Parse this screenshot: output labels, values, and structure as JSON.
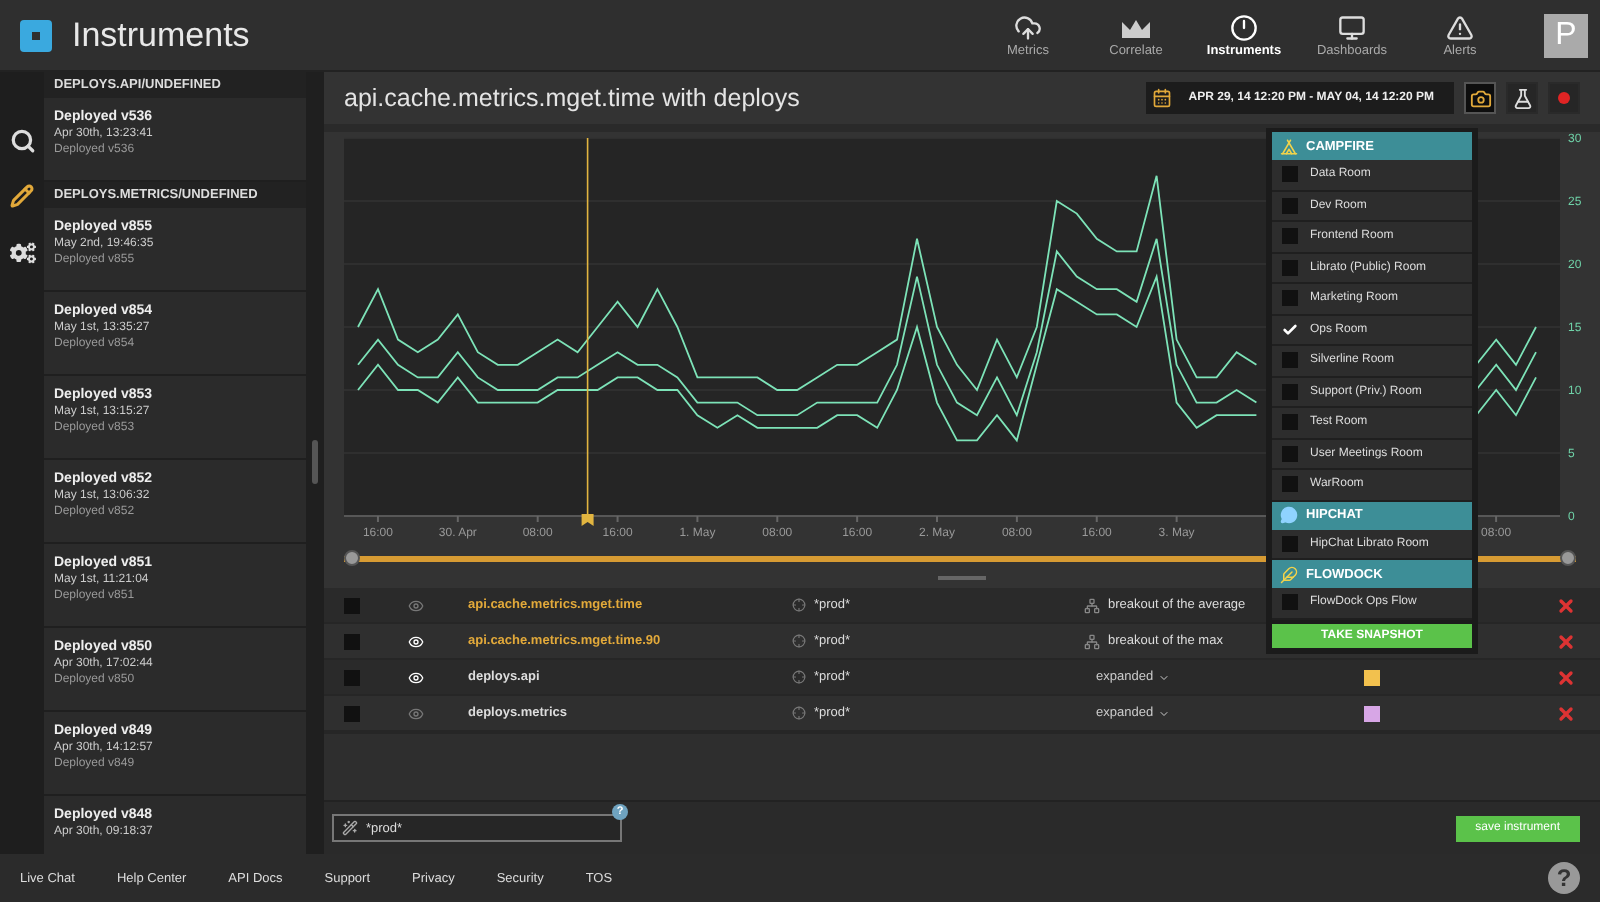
{
  "app": {
    "title": "Instruments",
    "avatar": "P"
  },
  "nav": [
    {
      "label": "Metrics",
      "kind": "metrics",
      "selected": false
    },
    {
      "label": "Correlate",
      "kind": "correlate",
      "selected": false
    },
    {
      "label": "Instruments",
      "kind": "instruments",
      "selected": true
    },
    {
      "label": "Dashboards",
      "kind": "dashboards",
      "selected": false
    },
    {
      "label": "Alerts",
      "kind": "alerts",
      "selected": false
    }
  ],
  "rail": [
    {
      "kind": "search",
      "selected": false
    },
    {
      "kind": "edit",
      "selected": true
    },
    {
      "kind": "settings",
      "selected": false
    }
  ],
  "deploys": [
    {
      "heading": "DEPLOYS.API/UNDEFINED",
      "items": [
        {
          "title": "Deployed v536",
          "time": "Apr 30th, 13:23:41",
          "note": "Deployed v536"
        }
      ]
    },
    {
      "heading": "DEPLOYS.METRICS/UNDEFINED",
      "items": [
        {
          "title": "Deployed v855",
          "time": "May 2nd, 19:46:35",
          "note": "Deployed v855"
        },
        {
          "title": "Deployed v854",
          "time": "May 1st, 13:35:27",
          "note": "Deployed v854"
        },
        {
          "title": "Deployed v853",
          "time": "May 1st, 13:15:27",
          "note": "Deployed v853"
        },
        {
          "title": "Deployed v852",
          "time": "May 1st, 13:06:32",
          "note": "Deployed v852"
        },
        {
          "title": "Deployed v851",
          "time": "May 1st, 11:21:04",
          "note": "Deployed v851"
        },
        {
          "title": "Deployed v850",
          "time": "Apr 30th, 17:02:44",
          "note": "Deployed v850"
        },
        {
          "title": "Deployed v849",
          "time": "Apr 30th, 14:12:57",
          "note": "Deployed v849"
        },
        {
          "title": "Deployed v848",
          "time": "Apr 30th, 09:18:37"
        }
      ]
    }
  ],
  "instrument": {
    "title": "api.cache.metrics.mget.time with deploys",
    "date_range": "APR 29, 14 12:20 PM - MAY 04, 14 12:20 PM",
    "tools": [
      {
        "kind": "snapshot",
        "selected": true
      },
      {
        "kind": "flask",
        "selected": false
      },
      {
        "kind": "record",
        "selected": false
      }
    ],
    "chart_data": {
      "type": "line",
      "categories": [
        null,
        "16:00",
        null,
        null,
        null,
        "30. Apr",
        null,
        null,
        null,
        "08:00",
        null,
        null,
        null,
        "16:00",
        null,
        null,
        null,
        "1. May",
        null,
        null,
        null,
        "08:00",
        null,
        null,
        null,
        "16:00",
        null,
        null,
        null,
        "2. May",
        null,
        null,
        null,
        "08:00",
        null,
        null,
        null,
        "16:00",
        null,
        null,
        null,
        "3. May",
        null,
        null,
        null,
        null,
        null,
        null,
        null,
        null,
        null,
        null,
        null,
        null,
        null,
        null,
        null,
        "08:00",
        null,
        null
      ],
      "series": [
        {
          "color": "#7de3b8",
          "values": [
            15,
            18,
            14,
            13,
            14,
            16,
            13,
            12,
            12,
            13,
            14,
            13,
            15,
            17,
            15,
            18,
            15,
            11,
            11,
            11,
            11,
            10,
            10,
            11,
            12,
            12,
            13,
            14,
            22,
            15,
            12,
            10,
            14,
            11,
            15,
            25,
            24,
            22,
            21,
            21,
            27,
            14,
            11,
            11,
            13,
            12,
            null,
            null,
            null,
            null,
            null,
            null,
            null,
            null,
            null,
            null,
            12,
            14,
            12,
            15
          ]
        },
        {
          "color": "#7de3b8",
          "values": [
            12,
            14,
            12,
            11,
            11,
            13,
            11,
            10,
            10,
            10,
            11,
            11,
            12,
            13,
            12,
            12,
            11,
            9,
            9,
            9,
            8,
            8,
            8,
            9,
            9,
            9,
            9,
            12,
            19,
            12,
            9,
            8,
            11,
            8,
            13,
            21,
            19,
            18,
            18,
            17,
            22,
            12,
            9,
            9,
            10,
            9,
            null,
            null,
            null,
            null,
            null,
            null,
            null,
            null,
            null,
            null,
            10,
            12,
            10,
            13
          ]
        },
        {
          "color": "#7de3b8",
          "values": [
            10,
            12,
            10,
            10,
            9,
            11,
            9,
            9,
            9,
            9,
            10,
            10,
            10,
            11,
            11,
            10,
            10,
            8,
            7,
            8,
            7,
            7,
            7,
            7,
            8,
            8,
            7,
            10,
            15,
            9,
            6,
            6,
            8,
            6,
            12,
            18,
            17,
            16,
            16,
            15,
            19,
            9,
            7,
            8,
            8,
            8,
            null,
            null,
            null,
            null,
            null,
            null,
            null,
            null,
            null,
            null,
            8,
            10,
            8,
            11
          ]
        }
      ],
      "ylim": [
        0,
        30
      ],
      "yticks": [
        0,
        5,
        10,
        15,
        20,
        25,
        30
      ],
      "grid": true
    },
    "navigator": {
      "level": 1
    },
    "streams": [
      {
        "kind": "metric",
        "checked": false,
        "visible": false,
        "name": "api.cache.metrics.mget.time",
        "source": "*prod*",
        "summary": "breakout of the average"
      },
      {
        "kind": "metric",
        "checked": false,
        "visible": true,
        "name": "api.cache.metrics.mget.time.90",
        "source": "*prod*",
        "summary": "breakout of the max"
      },
      {
        "kind": "annotation",
        "checked": false,
        "visible": true,
        "name": "deploys.api",
        "source": "*prod*",
        "summary": "expanded",
        "color": "#f2c14e"
      },
      {
        "kind": "annotation",
        "checked": false,
        "visible": false,
        "name": "deploys.metrics",
        "source": "*prod*",
        "summary": "expanded",
        "color": "#d7a6e6"
      }
    ],
    "filter": {
      "value": "*prod*",
      "help": "?"
    },
    "save": "save instrument"
  },
  "snapshot_menu": {
    "groups": [
      {
        "kind": "campfire",
        "name": "CAMPFIRE",
        "rooms": [
          {
            "label": "Data Room",
            "checked": false
          },
          {
            "label": "Dev Room",
            "checked": false
          },
          {
            "label": "Frontend Room",
            "checked": false
          },
          {
            "label": "Librato (Public) Room",
            "checked": false
          },
          {
            "label": "Marketing Room",
            "checked": false
          },
          {
            "label": "Ops Room",
            "checked": true
          },
          {
            "label": "Silverline Room",
            "checked": false
          },
          {
            "label": "Support (Priv.) Room",
            "checked": false
          },
          {
            "label": "Test Room",
            "checked": false
          },
          {
            "label": "User Meetings Room",
            "checked": false
          },
          {
            "label": "WarRoom",
            "checked": false
          }
        ]
      },
      {
        "kind": "hipchat",
        "name": "HIPCHAT",
        "rooms": [
          {
            "label": "HipChat Librato Room",
            "checked": false
          }
        ]
      },
      {
        "kind": "flowdock",
        "name": "FLOWDOCK",
        "rooms": [
          {
            "label": "FlowDock Ops Flow",
            "checked": false
          }
        ]
      }
    ],
    "button": "TAKE SNAPSHOT"
  },
  "footer": {
    "links": [
      "Live Chat",
      "Help Center",
      "API Docs",
      "Support",
      "Privacy",
      "Security",
      "TOS"
    ],
    "help": "?"
  }
}
